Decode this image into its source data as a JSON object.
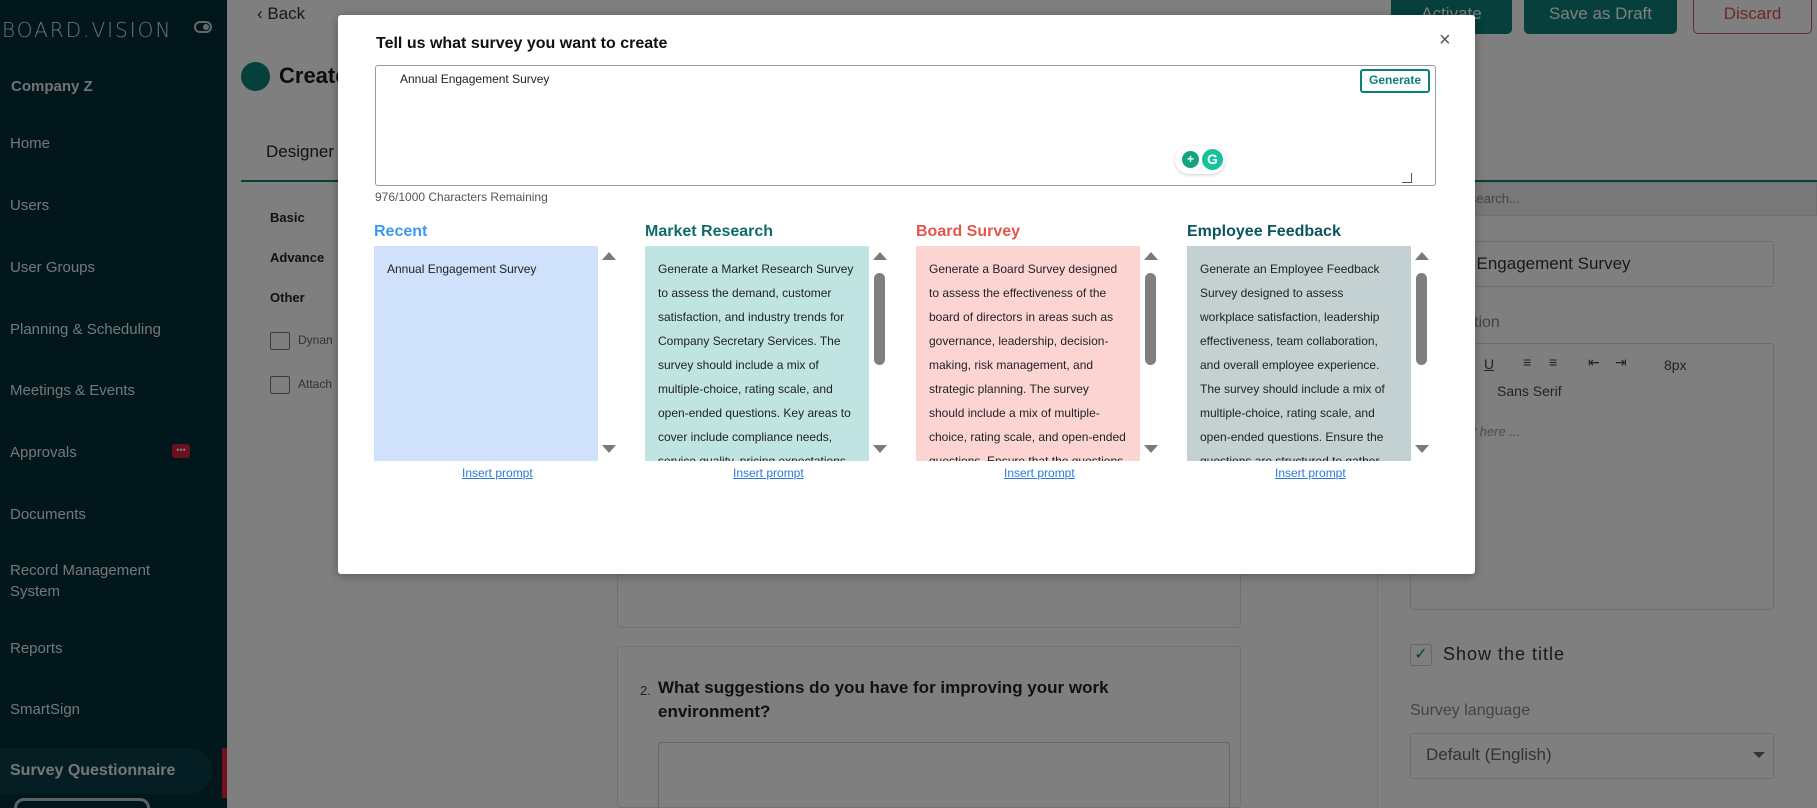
{
  "sidebar": {
    "brand": "BOARD.VISION",
    "company": "Company Z",
    "items": [
      {
        "label": "Home"
      },
      {
        "label": "Users"
      },
      {
        "label": "User Groups"
      },
      {
        "label": "Planning & Scheduling"
      },
      {
        "label": "Meetings & Events"
      },
      {
        "label": "Approvals"
      },
      {
        "label": "Documents"
      },
      {
        "label": "Record Management System"
      },
      {
        "label": "Reports"
      },
      {
        "label": "SmartSign"
      },
      {
        "label": "Survey Questionnaire"
      }
    ],
    "badge_icon": "chat-icon"
  },
  "page": {
    "back": "Back",
    "create_title": "Create",
    "buttons": {
      "activate": "Activate",
      "save_draft": "Save as Draft",
      "discard": "Discard"
    },
    "designer_tab": "Designer",
    "categories": [
      "Basic",
      "Advance",
      "Other"
    ],
    "tools": [
      "Dynan",
      "Attach"
    ],
    "question": {
      "number": "2.",
      "text": "What suggestions do you have for improving your work environment?"
    },
    "right_panel": {
      "search_placeholder": "search...",
      "title_value": "l Engagement Survey",
      "description_label": "tion",
      "font_size": "8px",
      "font_family": "Sans Serif",
      "editor_placeholder": "xt here ...",
      "show_title_label": "Show the title",
      "language_label": "Survey language",
      "language_value": "Default (English)"
    }
  },
  "modal": {
    "title": "Tell us what survey you want to create",
    "close": "×",
    "prompt_value": "Annual Engagement Survey",
    "generate": "Generate",
    "chars_remaining": "976/1000 Characters Remaining",
    "insert_label": "Insert prompt",
    "columns": [
      {
        "title": "Recent",
        "color": "#3b99f0",
        "bg": "#cfe1fb",
        "text": "Annual Engagement Survey"
      },
      {
        "title": "Market Research",
        "color": "#0d6e67",
        "bg": "#bfe4e1",
        "text": "Generate a Market Research Survey to assess the demand, customer satisfaction, and industry trends for Company Secretary Services. The survey should include a mix of multiple-choice, rating scale, and open-ended questions. Key areas to cover include compliance needs, service quality, pricing expectations"
      },
      {
        "title": "Board Survey",
        "color": "#e4564b",
        "bg": "#fcd5d3",
        "text": "Generate a Board Survey designed to assess the effectiveness of the board of directors in areas such as governance, leadership, decision-making, risk management, and strategic planning. The survey should include a mix of multiple-choice, rating scale, and open-ended questions. Ensure that the questions"
      },
      {
        "title": "Employee Feedback",
        "color": "#0c5560",
        "bg": "#c3d1d3",
        "text": "Generate an Employee Feedback Survey designed to assess workplace satisfaction, leadership effectiveness, team collaboration, and overall employee experience. The survey should include a mix of multiple-choice, rating scale, and open-ended questions. Ensure the questions are structured to gather"
      }
    ]
  }
}
